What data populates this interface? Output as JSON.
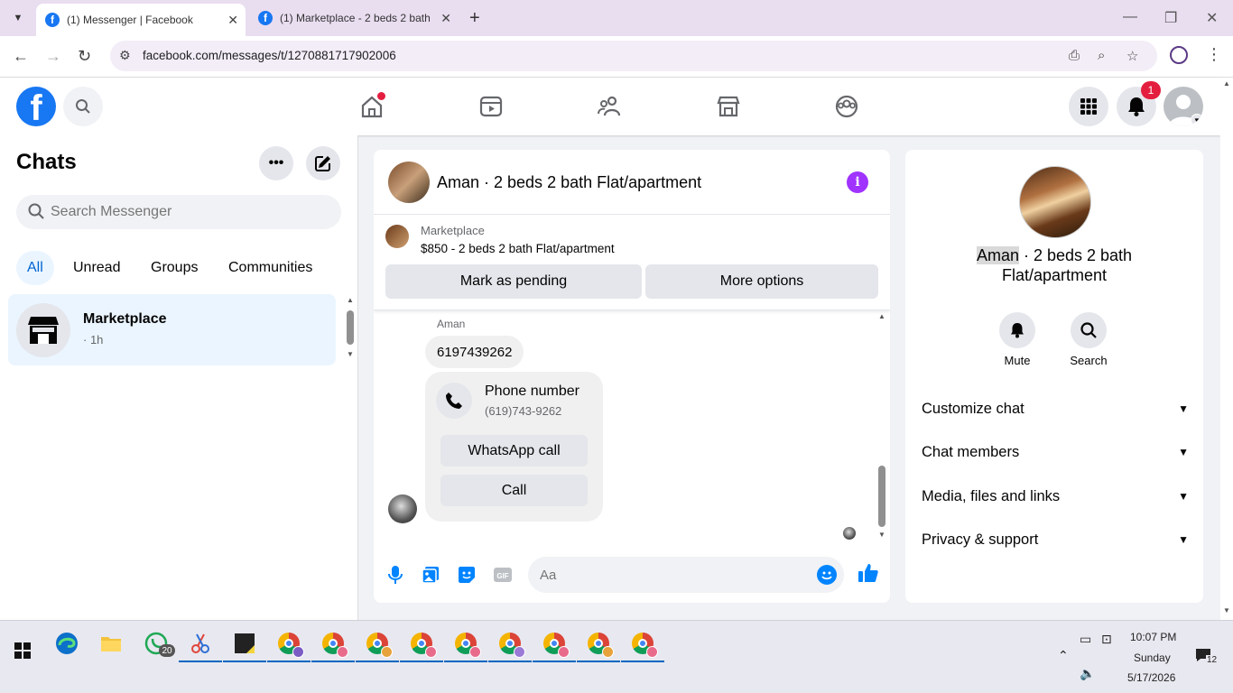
{
  "browser": {
    "tabs": [
      {
        "title": "(1) Messenger | Facebook",
        "active": true
      },
      {
        "title": "(1) Marketplace - 2 beds 2 bath",
        "active": false
      }
    ],
    "url": "facebook.com/messages/t/1270881717902006"
  },
  "fb_nav": {
    "notification_count": "1",
    "colors": {
      "brand": "#1877f2",
      "badge": "#e41e3f"
    }
  },
  "left_panel": {
    "title": "Chats",
    "search_placeholder": "Search Messenger",
    "filters": [
      "All",
      "Unread",
      "Groups",
      "Communities"
    ],
    "active_filter": "All",
    "chats": [
      {
        "name": "Marketplace",
        "time": "· 1h"
      }
    ]
  },
  "conversation": {
    "title": "Aman · 2 beds 2 bath Flat/apartment",
    "marketplace": {
      "label": "Marketplace",
      "listing": "$850 - 2 beds 2 bath Flat/apartment",
      "buttons": [
        "Mark as pending",
        "More options"
      ]
    },
    "sender": "Aman",
    "message": "6197439262",
    "phone_card": {
      "title": "Phone number",
      "number": "(619)743-9262",
      "buttons": [
        "WhatsApp call",
        "Call"
      ]
    },
    "composer_placeholder": "Aa",
    "accent_color": "#0084ff"
  },
  "info_panel": {
    "name_highlight": "Aman",
    "name_rest": " · 2 beds 2 bath Flat/apartment",
    "actions": [
      "Mute",
      "Search"
    ],
    "sections": [
      "Customize chat",
      "Chat members",
      "Media, files and links",
      "Privacy & support"
    ]
  },
  "taskbar": {
    "whatsapp_badge": "20",
    "time": "10:07 PM",
    "day": "Sunday",
    "date": "5/17/2026",
    "notification_count": "12"
  }
}
